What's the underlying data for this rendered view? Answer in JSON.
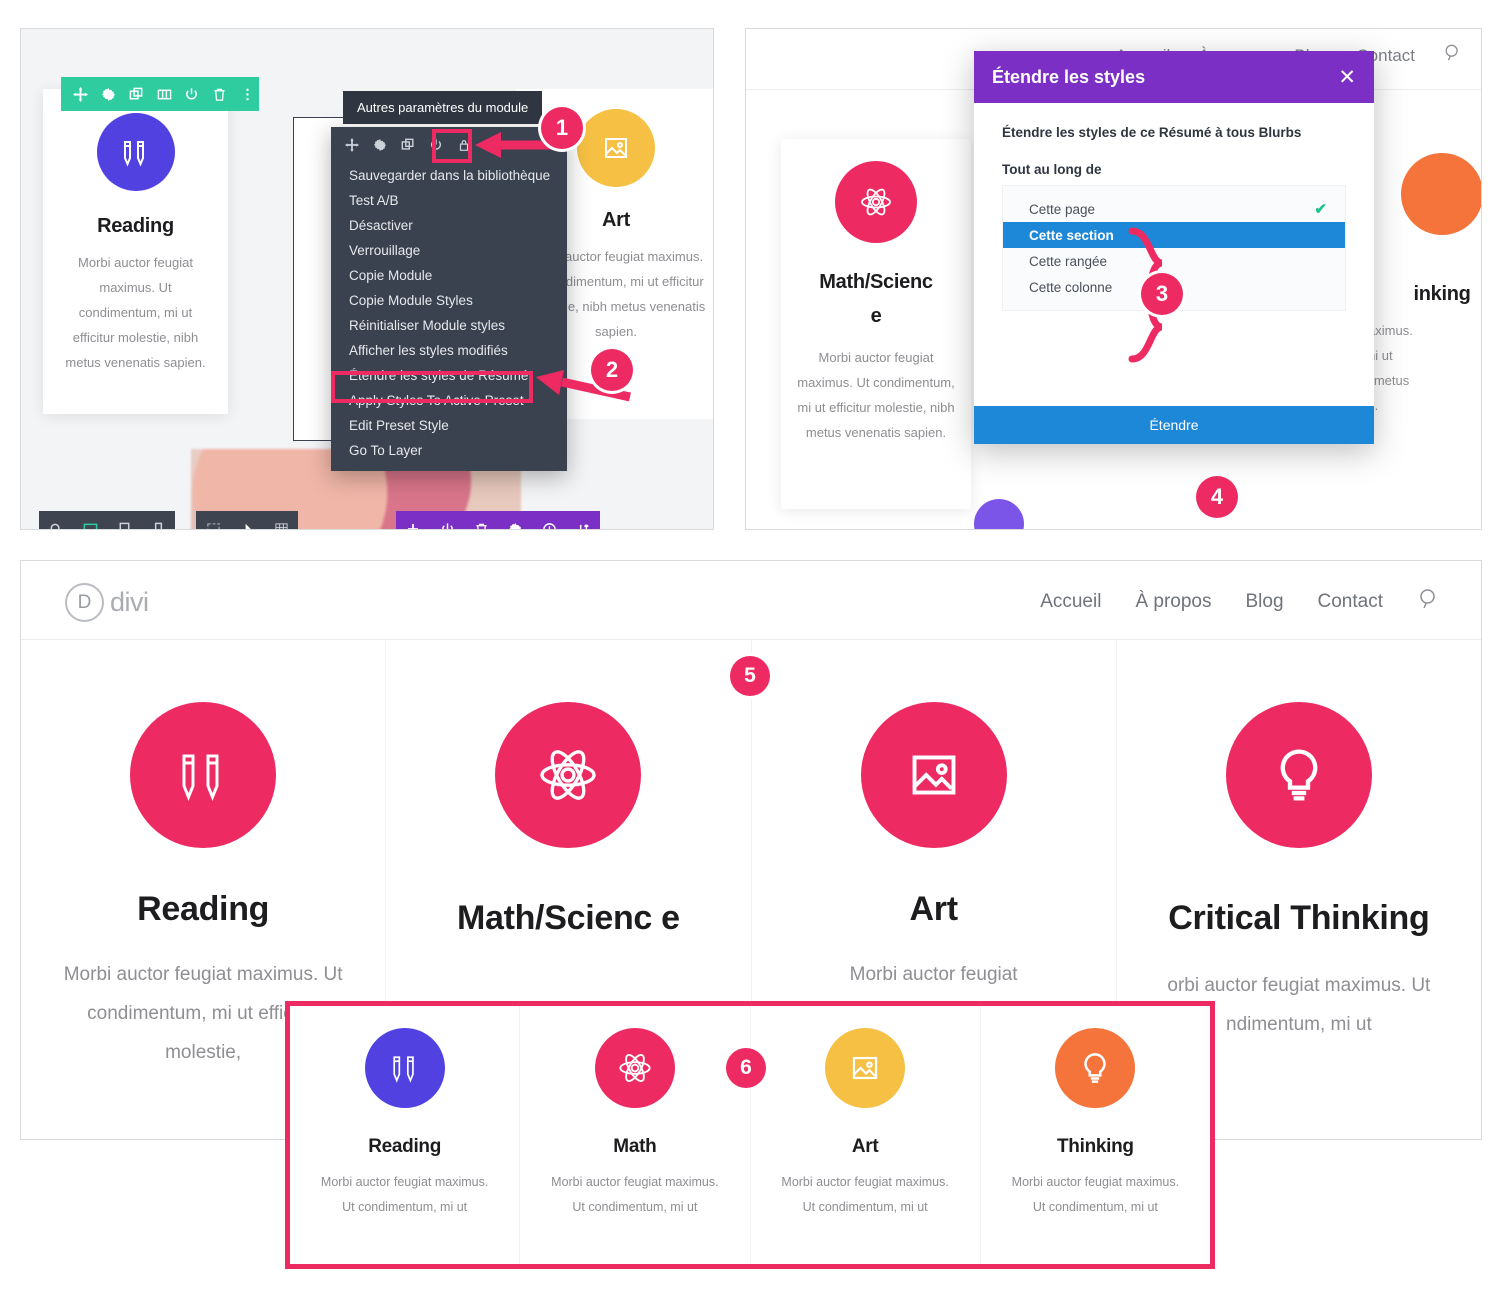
{
  "panel1": {
    "tooltip": "Autres paramètres du module",
    "module_toolbar_icons": [
      "move-icon",
      "gear-icon",
      "duplicate-icon",
      "column-icon",
      "power-icon",
      "trash-icon",
      "kebab-menu-icon"
    ],
    "context_toolbar_icons": [
      "move-icon",
      "gear-icon",
      "duplicate-icon",
      "power-icon",
      "lock-icon",
      "kebab-menu-icon"
    ],
    "menu_items": [
      "Sauvegarder dans la bibliothèque",
      "Test A/B",
      "Désactiver",
      "Verrouillage",
      "Copie Module",
      "Copie Module Styles",
      "Réinitialiser Module styles",
      "Afficher les styles modifiés",
      "Étendre les styles de Résumé",
      "Apply Styles To Active Preset",
      "Edit Preset Style",
      "Go To Layer"
    ],
    "highlighted_menu_item": "Étendre les styles de Résumé",
    "cards": [
      {
        "icon": "pencils-icon",
        "icon_color": "#5041E0",
        "title": "Reading",
        "body": "Morbi auctor feugiat maximus. Ut condimentum, mi ut efficitur molestie, nibh metus venenatis sapien."
      },
      {
        "icon": "image-icon",
        "icon_color": "#F5C043",
        "title": "Art",
        "body": "Morbi auctor feugiat maximus. Ut condimentum, mi ut efficitur molestie, nibh metus venenatis sapien."
      }
    ],
    "bottom_bar_left_icons": [
      "zoom-icon",
      "desktop-icon",
      "tablet-icon",
      "phone-icon"
    ],
    "bottom_bar_mid_icons": [
      "wireframe-icon",
      "click-icon",
      "grid-icon"
    ],
    "bottom_bar_purple_icons": [
      "plus-icon",
      "power-icon",
      "trash-icon",
      "gear-icon",
      "history-icon",
      "sort-icon"
    ]
  },
  "panel2": {
    "nav_links": [
      "Accueil",
      "À propos",
      "Blog",
      "Contact"
    ],
    "search_icon": "search-icon",
    "modal": {
      "title": "Étendre les styles",
      "close_icon": "close-icon",
      "description": "Étendre les styles de ce Résumé à tous Blurbs",
      "label": "Tout au long de",
      "options": [
        {
          "label": "Cette page",
          "selected": false,
          "checked": true
        },
        {
          "label": "Cette section",
          "selected": true,
          "checked": false
        },
        {
          "label": "Cette rangée",
          "selected": false,
          "checked": false
        },
        {
          "label": "Cette colonne",
          "selected": false,
          "checked": false
        }
      ],
      "check_mark": "✔",
      "submit_label": "Étendre"
    },
    "card": {
      "icon": "atom-icon",
      "icon_color": "#EE2A62",
      "title": "Math/Scienc\ne",
      "body": "Morbi auctor feugiat maximus. Ut condimentum, mi ut efficitur molestie, nibh metus venenatis sapien."
    },
    "partial_card": {
      "icon_color": "#F4743B",
      "title_fragment": "inking",
      "body_lines": [
        "t maximus.",
        "n, mi ut",
        "iibh metus",
        "oien."
      ]
    }
  },
  "panel3": {
    "logo_mark": "D",
    "logo_word": "divi",
    "nav_links": [
      "Accueil",
      "À propos",
      "Blog",
      "Contact"
    ],
    "search_icon": "search-icon",
    "cards": [
      {
        "icon": "pencils-icon",
        "icon_color": "#EE2A62",
        "title": "Reading",
        "body": "Morbi auctor feugiat maximus. Ut condimentum, mi ut efficitur molestie,"
      },
      {
        "icon": "atom-icon",
        "icon_color": "#EE2A62",
        "title": "Math/Scienc e",
        "body": ""
      },
      {
        "icon": "image-icon",
        "icon_color": "#EE2A62",
        "title": "Art",
        "body": "Morbi auctor feugiat"
      },
      {
        "icon": "bulb-icon",
        "icon_color": "#EE2A62",
        "title": "Critical Thinking",
        "body": "orbi auctor feugiat maximus. Ut ndimentum, mi ut"
      }
    ]
  },
  "inset": {
    "cards": [
      {
        "icon": "pencils-icon",
        "icon_color": "#5041E0",
        "title": "Reading",
        "body": "Morbi auctor feugiat maximus. Ut condimentum, mi ut"
      },
      {
        "icon": "atom-icon",
        "icon_color": "#EE2A62",
        "title": "Math",
        "body": "Morbi auctor feugiat maximus. Ut condimentum, mi ut"
      },
      {
        "icon": "image-icon",
        "icon_color": "#F5C043",
        "title": "Art",
        "body": "Morbi auctor feugiat maximus. Ut condimentum, mi ut"
      },
      {
        "icon": "bulb-icon",
        "icon_color": "#F4743B",
        "title": "Thinking",
        "body": "Morbi auctor feugiat maximus. Ut condimentum, mi ut"
      }
    ]
  },
  "callouts": [
    {
      "number": "1"
    },
    {
      "number": "2"
    },
    {
      "number": "3"
    },
    {
      "number": "4"
    },
    {
      "number": "5"
    },
    {
      "number": "6"
    }
  ],
  "colors": {
    "accent_pink": "#EE2A62",
    "purple": "#7B2FC4",
    "blue": "#1E88D8",
    "green_toolbar": "#2ECC9F",
    "dark_menu": "#3A4250",
    "indigo": "#5041E0",
    "yellow": "#F5C043",
    "orange": "#F4743B",
    "check_green": "#1EC48F"
  }
}
